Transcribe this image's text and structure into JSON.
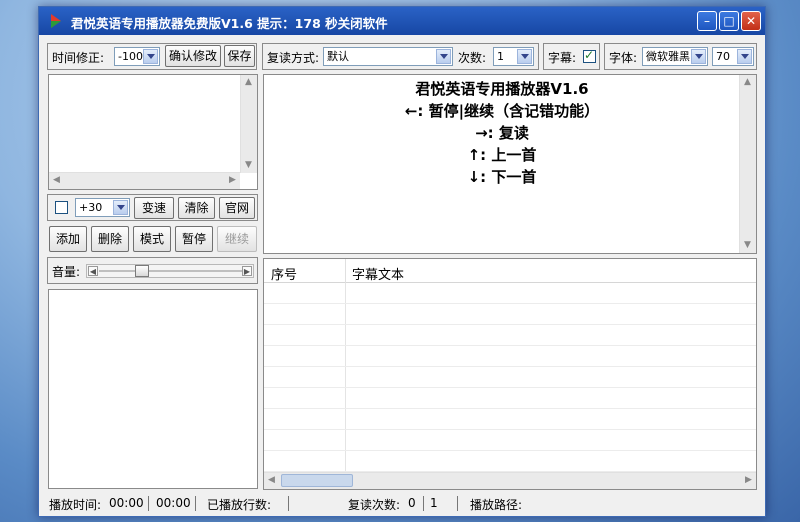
{
  "window": {
    "title": "君悦英语专用播放器免费版V1.6 提示：178 秒关闭软件"
  },
  "toolbar": {
    "time_adjust_label": "时间修正:",
    "time_adjust_value": "-100",
    "confirm_label": "确认修改",
    "save_label": "保存",
    "repeat_mode_label": "复读方式:",
    "repeat_mode_value": "默认",
    "count_label": "次数:",
    "count_value": "1",
    "subtitle_label": "字幕:",
    "subtitle_checked": true,
    "font_label": "字体:",
    "font_value": "微软雅黑",
    "font_size_value": "70"
  },
  "speed": {
    "enabled": false,
    "value": "+30",
    "change_label": "变速",
    "clear_label": "清除",
    "website_label": "官网"
  },
  "controls": {
    "add_label": "添加",
    "delete_label": "删除",
    "mode_label": "模式",
    "pause_label": "暂停",
    "resume_label": "继续",
    "volume_label": "音量:"
  },
  "lyrics": [
    "君悦英语专用播放器V1.6",
    "←: 暂停|继续（含记错功能）",
    "→: 复读",
    "↑: 上一首",
    "↓: 下一首"
  ],
  "subtitle_table": {
    "columns": [
      "序号",
      "字幕文本"
    ],
    "rows": []
  },
  "statusbar": {
    "play_time_label": "播放时间:",
    "current_time": "00:00",
    "total_time": "00:00",
    "played_lines_label": "已播放行数:",
    "played_lines_value": "",
    "repeat_count_label": "复读次数:",
    "repeat_count_value": "0",
    "repeat_total": "1",
    "play_path_label": "播放路径:",
    "play_path_value": ""
  }
}
